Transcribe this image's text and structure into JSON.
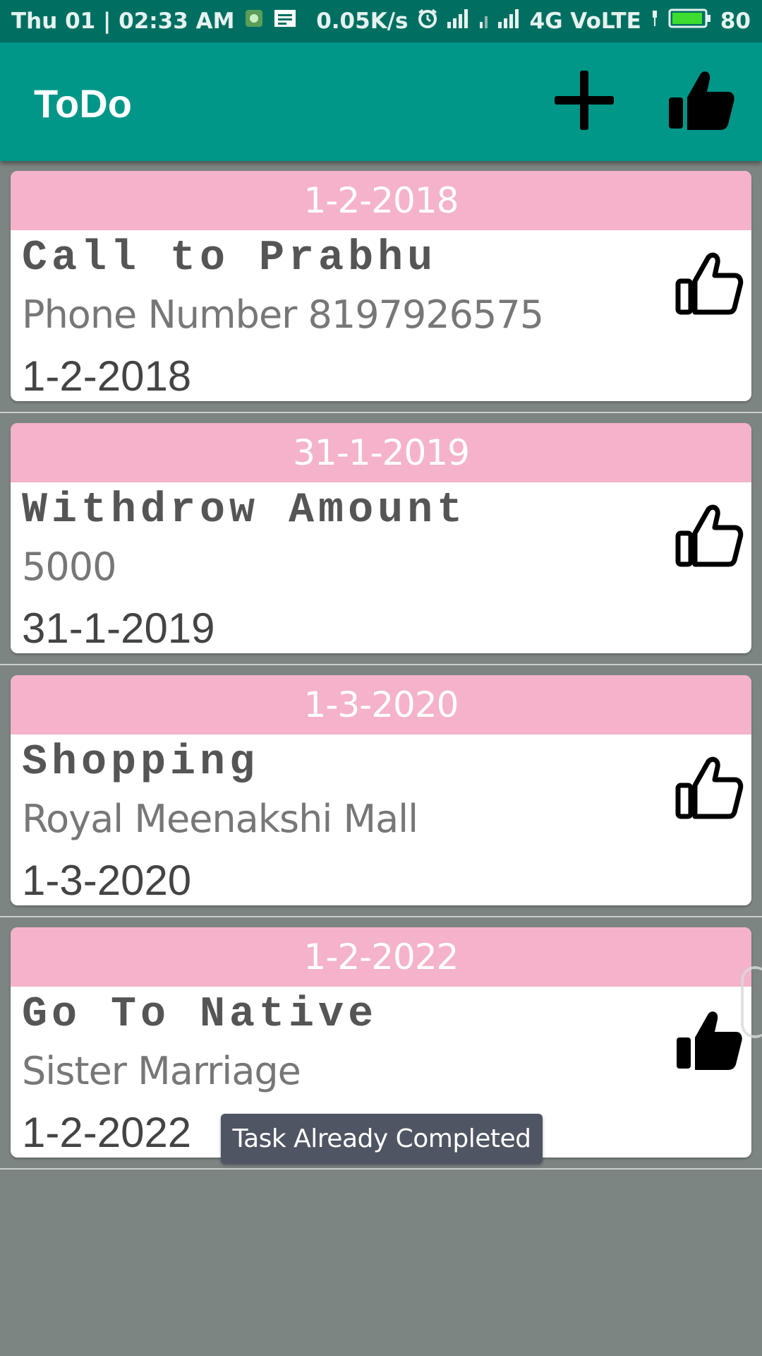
{
  "status_bar": {
    "time": "Thu 01 | 02:33 AM",
    "speed": "0.05K/s",
    "network": "4G VoLTE",
    "battery": "80"
  },
  "app_bar": {
    "title": "ToDo",
    "add_icon": "plus-icon",
    "completed_icon": "thumbs-up-filled-icon"
  },
  "tasks": [
    {
      "header_date": "1-2-2018",
      "title": "Call to Prabhu",
      "description": "Phone Number   8197926575",
      "date": "1-2-2018",
      "icon": "thumbs-up-outline-icon"
    },
    {
      "header_date": "31-1-2019",
      "title": "Withdrow Amount",
      "description": "5000",
      "date": "31-1-2019",
      "icon": "thumbs-up-outline-icon"
    },
    {
      "header_date": "1-3-2020",
      "title": "Shopping",
      "description": "Royal Meenakshi Mall",
      "date": "1-3-2020",
      "icon": "thumbs-up-outline-icon"
    },
    {
      "header_date": "1-2-2022",
      "title": "Go To Native",
      "description": "Sister Marriage",
      "date": "1-2-2022",
      "icon": "thumbs-up-filled-icon"
    }
  ],
  "toast": {
    "message": "Task Already Completed"
  },
  "colors": {
    "app_bar": "#009688",
    "status_bar": "#006f62",
    "card_header": "#f4b3ca",
    "background": "#7d8583",
    "battery": "#3ddc2f"
  }
}
